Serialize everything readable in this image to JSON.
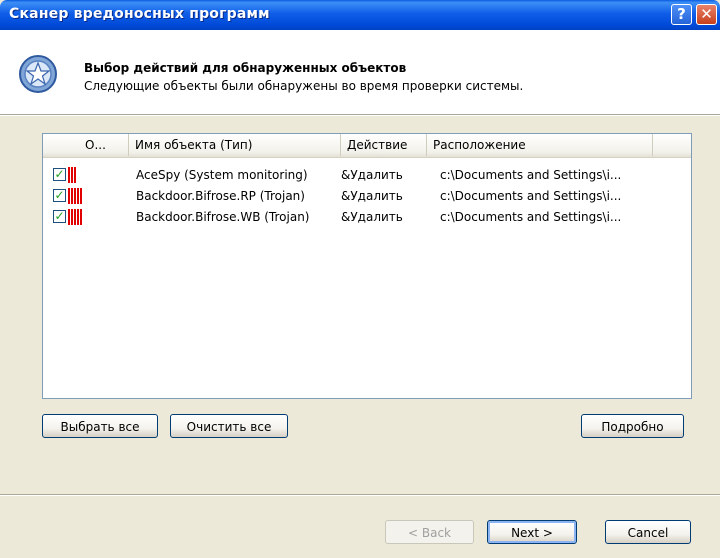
{
  "window": {
    "title": "Сканер вредоносных программ",
    "help_label": "?",
    "close_label": "✕"
  },
  "header": {
    "title": "Выбор действий для обнаруженных объектов",
    "subtitle": "Следующие объекты были обнаружены во время проверки системы."
  },
  "list": {
    "columns": [
      "О...",
      "Имя объекта (Тип)",
      "Действие",
      "Расположение"
    ],
    "rows": [
      {
        "checked": true,
        "severity": 3,
        "name": "AceSpy (System monitoring)",
        "action": "&Удалить",
        "location": "c:\\Documents and Settings\\i..."
      },
      {
        "checked": true,
        "severity": 5,
        "name": "Backdoor.Bifrose.RP (Trojan)",
        "action": "&Удалить",
        "location": "c:\\Documents and Settings\\i..."
      },
      {
        "checked": true,
        "severity": 5,
        "name": "Backdoor.Bifrose.WB (Trojan)",
        "action": "&Удалить",
        "location": "c:\\Documents and Settings\\i..."
      }
    ]
  },
  "buttons": {
    "select_all": "Выбрать все",
    "clear_all": "Очистить все",
    "details": "Подробно",
    "back": "< Back",
    "next": "Next >",
    "cancel": "Cancel"
  },
  "colors": {
    "title_bar": "#0055e5",
    "severity": "#e00000",
    "check": "#21a121"
  },
  "icons": {
    "header": "shield-star-icon",
    "check": "checkmark-icon",
    "severity": "severity-bars-icon"
  }
}
